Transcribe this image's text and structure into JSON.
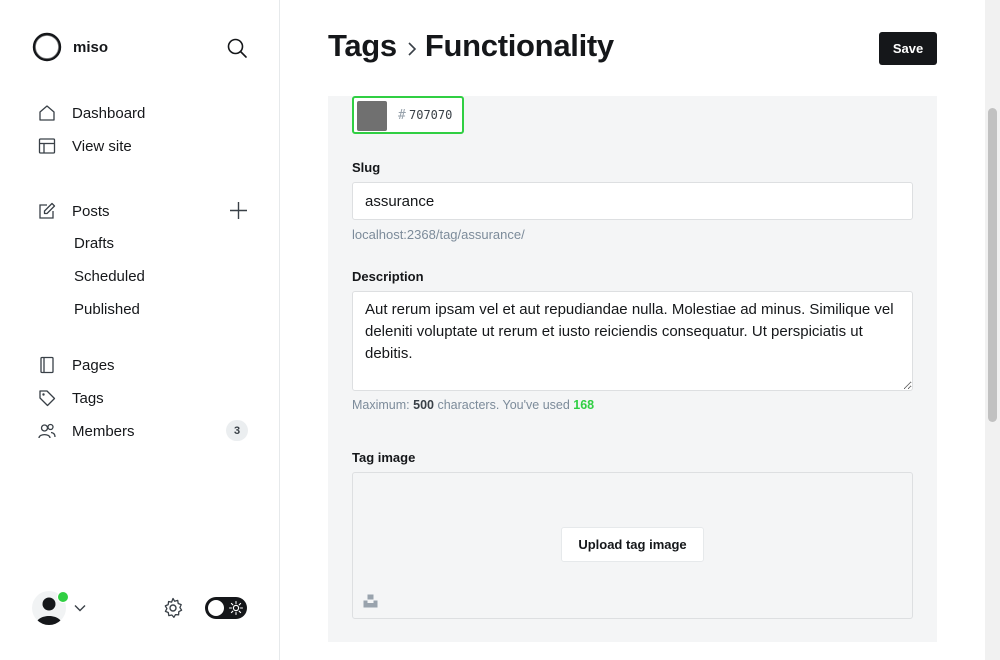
{
  "sidebar": {
    "site_name": "miso",
    "nav": [
      {
        "label": "Dashboard",
        "icon": "home-icon"
      },
      {
        "label": "View site",
        "icon": "layout-icon"
      }
    ],
    "posts": {
      "label": "Posts",
      "icon": "edit-icon",
      "sub": [
        "Drafts",
        "Scheduled",
        "Published"
      ]
    },
    "nav2": [
      {
        "label": "Pages",
        "icon": "page-icon"
      },
      {
        "label": "Tags",
        "icon": "tag-icon"
      },
      {
        "label": "Members",
        "icon": "members-icon",
        "count": "3"
      }
    ]
  },
  "header": {
    "breadcrumb_parent": "Tags",
    "title": "Functionality",
    "save_label": "Save"
  },
  "form": {
    "color": {
      "hash": "#",
      "value": "707070",
      "swatch": "#707070"
    },
    "slug": {
      "label": "Slug",
      "value": "assurance",
      "url": "localhost:2368/tag/assurance/"
    },
    "description": {
      "label": "Description",
      "value": "Aut rerum ipsam vel et aut repudiandae nulla. Molestiae ad minus. Similique vel deleniti voluptate ut rerum et iusto reiciendis consequatur. Ut perspiciatis ut debitis.",
      "hint_prefix": "Maximum: ",
      "hint_max": "500",
      "hint_middle": " characters. You've used ",
      "hint_used": "168"
    },
    "tag_image": {
      "label": "Tag image",
      "upload_label": "Upload tag image"
    }
  },
  "colors": {
    "accent_green": "#30cf43",
    "dark": "#15171a"
  }
}
